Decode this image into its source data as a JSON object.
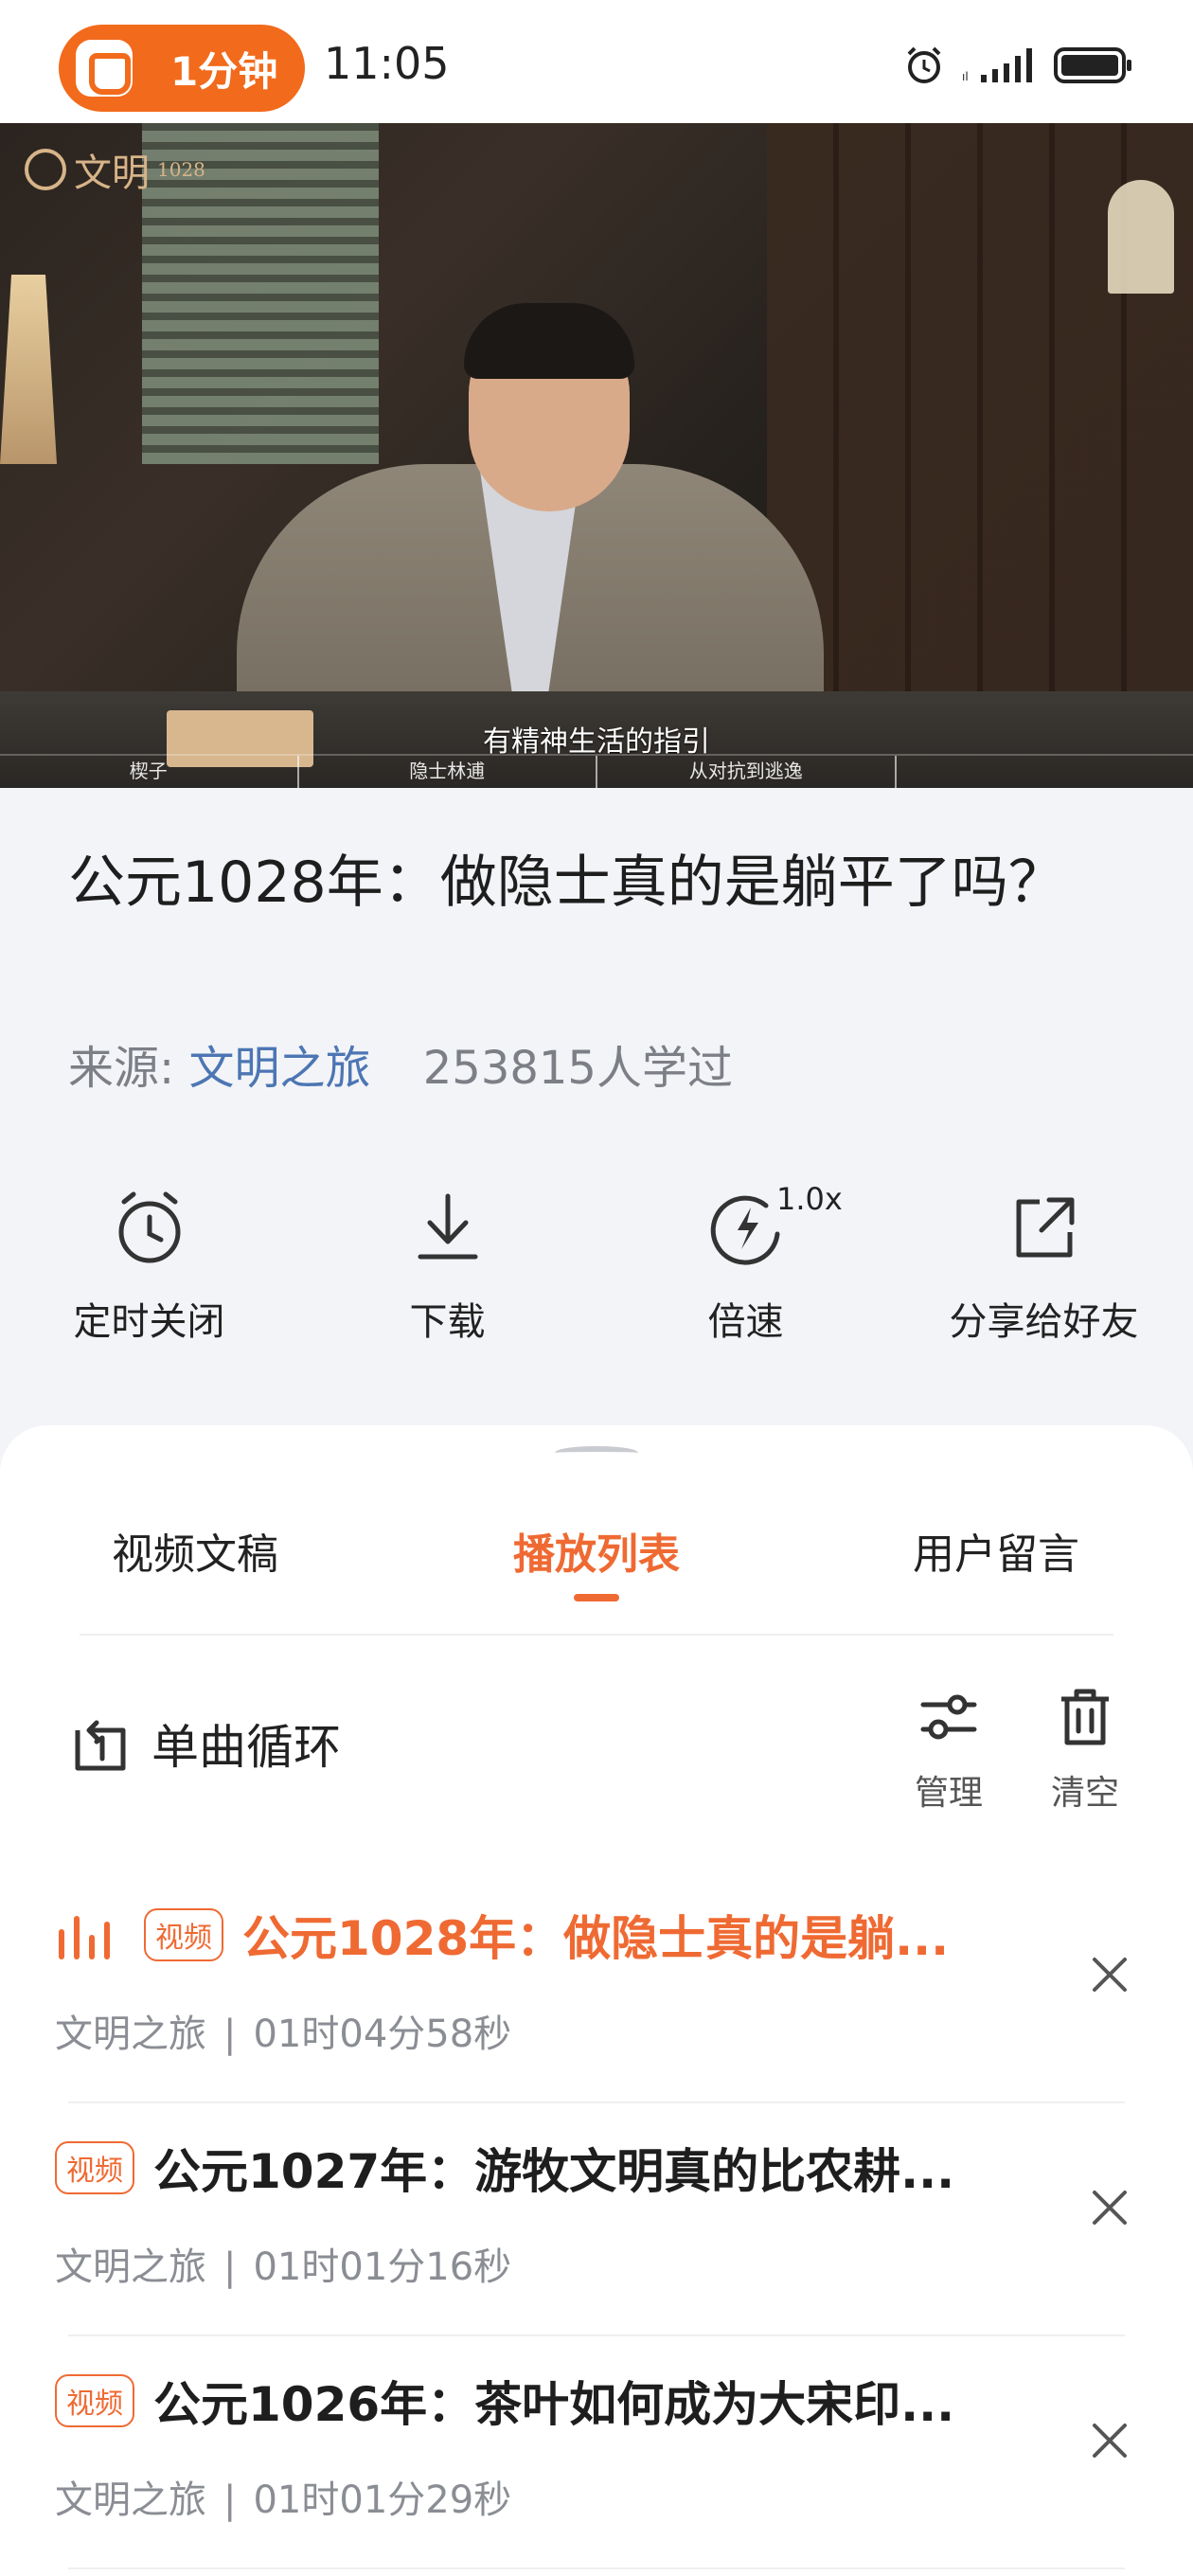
{
  "status_bar": {
    "pill_label": "1分钟",
    "time": "11:05"
  },
  "video": {
    "logo_name": "文明",
    "logo_number": "1028",
    "subtitle": "有精神生活的指引",
    "chapters": [
      "楔子",
      "隐士林逋",
      "从对抗到逃逸",
      ""
    ]
  },
  "info": {
    "title": "公元1028年：做隐士真的是躺平了吗？",
    "source_label": "来源:",
    "source_name": "文明之旅",
    "learners": "253815人学过"
  },
  "actions": {
    "timer_label": "定时关闭",
    "download_label": "下载",
    "speed_label": "倍速",
    "speed_value": "1.0x",
    "share_label": "分享给好友"
  },
  "tabs": {
    "transcript": "视频文稿",
    "playlist": "播放列表",
    "comments": "用户留言"
  },
  "playlist": {
    "loop_label": "单曲循环",
    "manage_label": "管理",
    "clear_label": "清空",
    "items": [
      {
        "badge": "视频",
        "title": "公元1028年：做隐士真的是躺...",
        "source": "文明之旅",
        "sep": "|",
        "duration": "01时04分58秒"
      },
      {
        "badge": "视频",
        "title": "公元1027年：游牧文明真的比农耕...",
        "source": "文明之旅",
        "sep": "|",
        "duration": "01时01分16秒"
      },
      {
        "badge": "视频",
        "title": "公元1026年：茶叶如何成为大宋印...",
        "source": "文明之旅",
        "sep": "|",
        "duration": "01时01分29秒"
      }
    ]
  },
  "colors": {
    "accent": "#ef6a33",
    "pill": "#f26a1b",
    "link": "#4c76b3"
  }
}
